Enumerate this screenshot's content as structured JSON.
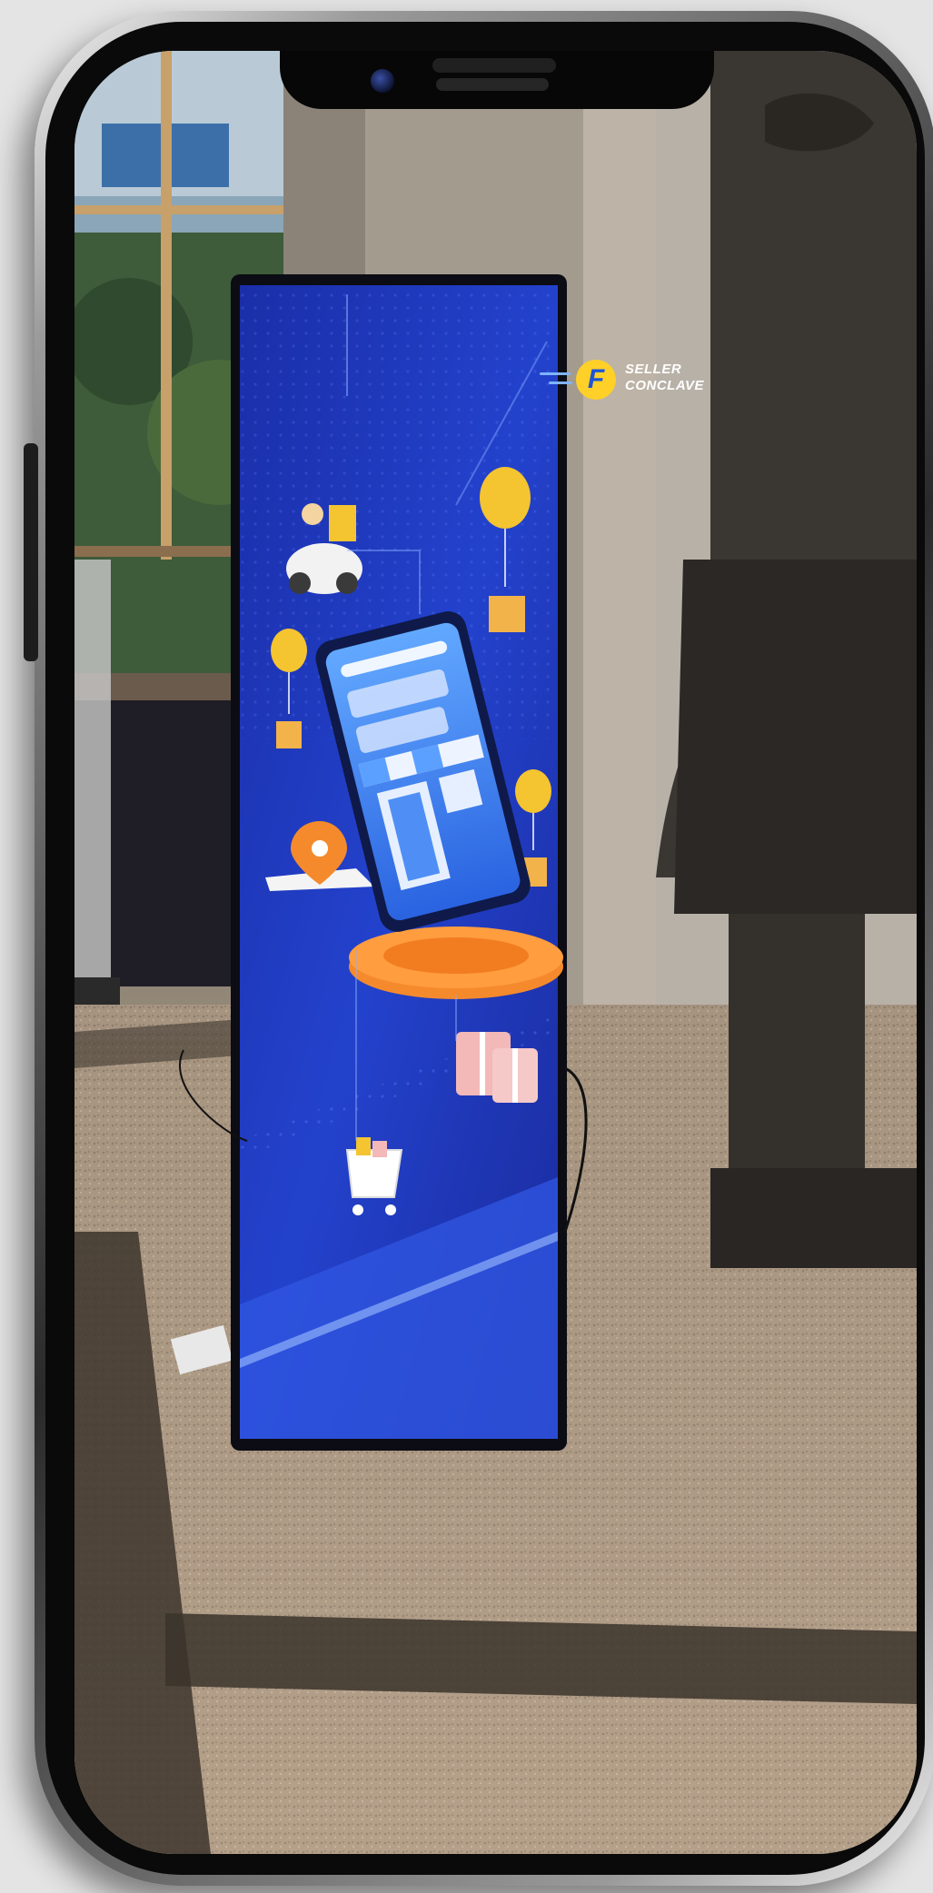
{
  "display_screen": {
    "logo": {
      "mark": "F",
      "line1": "SELLER",
      "line2": "CONCLAVE"
    }
  },
  "colors": {
    "display_blue": "#1f3fc4",
    "display_dark": "#16247a",
    "accent_yellow": "#f4c431",
    "accent_orange": "#f58a2c",
    "frame_black": "#0a0a0a",
    "floor": "#b09a83"
  },
  "icons": {
    "scooter": "scooter-icon",
    "balloon": "balloon-icon",
    "gift": "gift-box-icon",
    "location": "location-pin-icon",
    "cart": "shopping-cart-icon",
    "shop": "shop-phone-icon"
  }
}
